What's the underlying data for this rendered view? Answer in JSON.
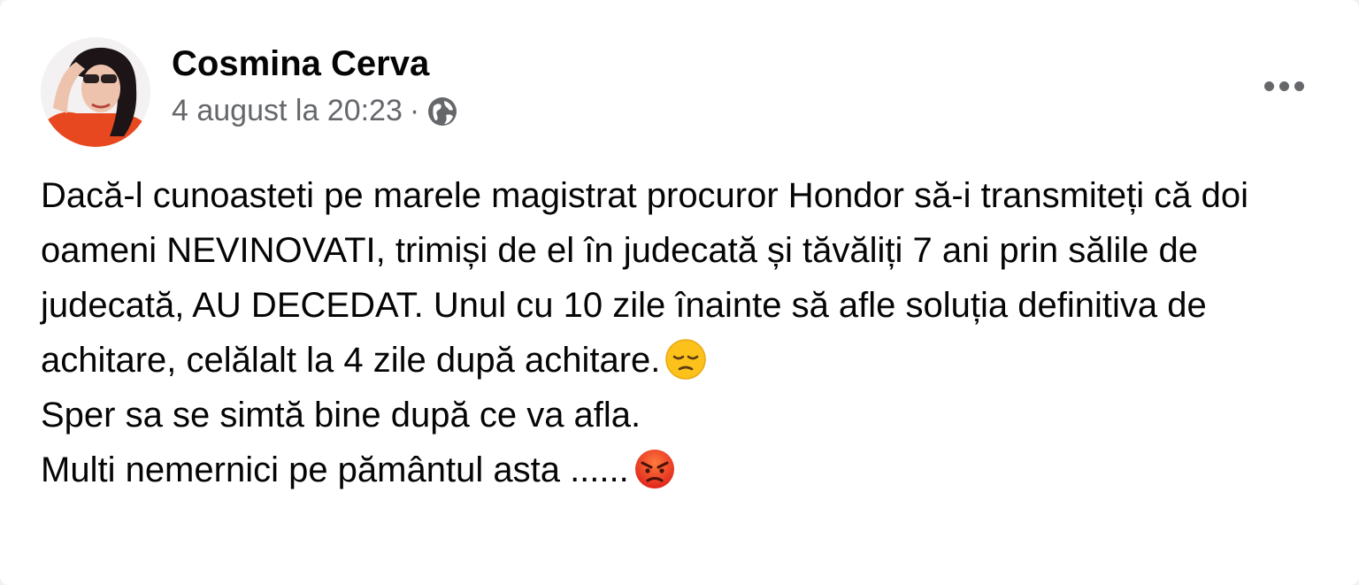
{
  "post": {
    "author": "Cosmina Cerva",
    "timestamp": "4 august la 20:23",
    "separator": "·",
    "audience_icon": "globe-icon",
    "menu_icon": "more-horizontal-icon",
    "paragraph_1": "Dacă-l cunoasteti pe marele magistrat procuror Hondor să-i transmiteți că doi oameni NEVINOVATI, trimiși de el în judecată și tăvăliți 7 ani prin sălile de judecată, AU DECEDAT. Unul cu 10 zile înainte să afle soluția definitiva de achitare, celălalt la 4 zile după achitare.",
    "emoji_1": "pensive-face-emoji",
    "paragraph_2": "Sper sa se simtă bine după ce va afla.",
    "paragraph_3": "Multi nemernici pe pământul asta ......",
    "emoji_2": "angry-face-emoji"
  },
  "colors": {
    "background": "#ffffff",
    "text": "#050505",
    "secondary_text": "#65676b"
  }
}
